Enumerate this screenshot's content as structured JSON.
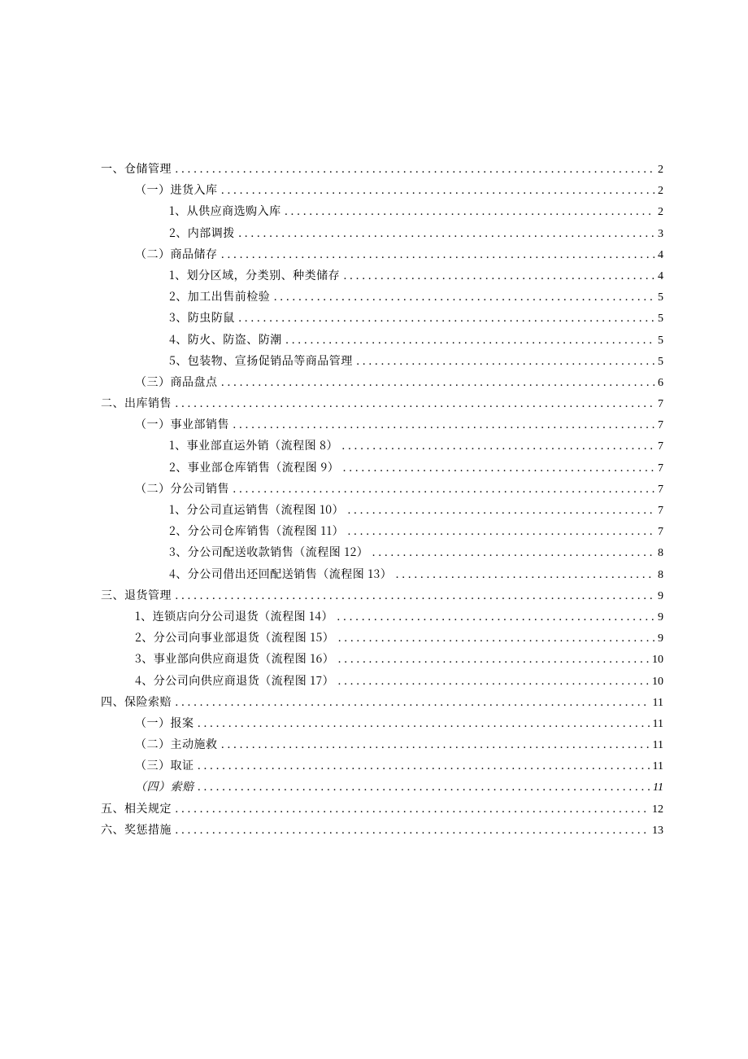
{
  "toc": [
    {
      "level": 0,
      "title": "一、仓储管理",
      "page": "2"
    },
    {
      "level": 1,
      "title": "（一）进货入库",
      "page": "2"
    },
    {
      "level": 2,
      "title": "1、从供应商选购入库",
      "page": "2"
    },
    {
      "level": 2,
      "title": "2、内部调拨",
      "page": "3"
    },
    {
      "level": 1,
      "title": "（二）商品储存",
      "page": "4"
    },
    {
      "level": 2,
      "title": "1、划分区域，分类别、种类储存",
      "page": "4"
    },
    {
      "level": 2,
      "title": "2、加工出售前检验",
      "page": "5"
    },
    {
      "level": 2,
      "title": "3、防虫防鼠",
      "page": "5"
    },
    {
      "level": 2,
      "title": "4、防火、防盗、防潮",
      "page": "5"
    },
    {
      "level": 2,
      "title": "5、包装物、宣扬促销品等商品管理",
      "page": "5"
    },
    {
      "level": 1,
      "title": "（三）商品盘点",
      "page": "6"
    },
    {
      "level": 0,
      "title": "二、出库销售",
      "page": "7"
    },
    {
      "level": 1,
      "title": "（一）事业部销售",
      "page": "7"
    },
    {
      "level": 2,
      "title": "1、事业部直运外销（流程图 8）",
      "page": "7"
    },
    {
      "level": 2,
      "title": "2、事业部仓库销售（流程图 9）",
      "page": "7"
    },
    {
      "level": 1,
      "title": "（二）分公司销售",
      "page": "7"
    },
    {
      "level": 2,
      "title": "1、分公司直运销售（流程图 10）",
      "page": "7"
    },
    {
      "level": 2,
      "title": "2、分公司仓库销售（流程图 11）",
      "page": "7"
    },
    {
      "level": 2,
      "title": "3、分公司配送收款销售（流程图 12）",
      "page": "8"
    },
    {
      "level": 2,
      "title": "4、分公司借出还回配送销售（流程图 13）",
      "page": "8"
    },
    {
      "level": 0,
      "title": "三、退货管理",
      "page": "9"
    },
    {
      "level": 1,
      "title": "1、连锁店向分公司退货（流程图 14）",
      "page": "9"
    },
    {
      "level": 1,
      "title": "2、分公司向事业部退货（流程图 15）",
      "page": "9"
    },
    {
      "level": 1,
      "title": "3、事业部向供应商退货（流程图 16）",
      "page": "10"
    },
    {
      "level": 1,
      "title": "4、分公司向供应商退货（流程图 17）",
      "page": "10"
    },
    {
      "level": 0,
      "title": "四、保险索赔",
      "page": "11"
    },
    {
      "level": 1,
      "title": "（一）报案",
      "page": "11"
    },
    {
      "level": 1,
      "title": "（二）主动施救",
      "page": "11"
    },
    {
      "level": 1,
      "title": "（三）取证",
      "page": "11"
    },
    {
      "level": 1,
      "title": "（四）索赔",
      "page": "11",
      "italic": true
    },
    {
      "level": 0,
      "title": "五、相关规定",
      "page": "12"
    },
    {
      "level": 0,
      "title": "六、奖惩措施",
      "page": "13"
    }
  ]
}
